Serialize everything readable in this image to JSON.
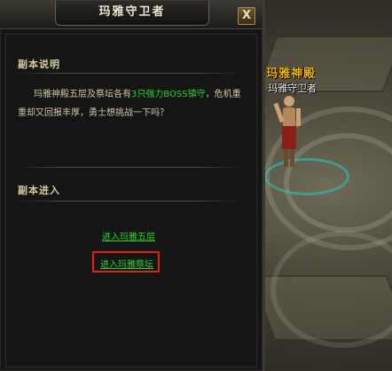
{
  "dialog": {
    "title": "玛雅守卫者",
    "close_label": "X",
    "desc_section": {
      "heading": "副本说明",
      "text_before": "玛雅神殿五层及祭坛各有",
      "text_highlight": "3只强力BOSS镇守",
      "text_after": "，危机重重却又回报丰厚，勇士想挑战一下吗？"
    },
    "enter_section": {
      "heading": "副本进入",
      "options": [
        {
          "label": "进入玛雅五层",
          "highlighted": false
        },
        {
          "label": "进入玛雅祭坛",
          "highlighted": true
        }
      ]
    }
  },
  "world": {
    "map_title": "玛雅神殿",
    "npc_name": "玛雅守卫者"
  },
  "colors": {
    "link_green": "#27d32c",
    "map_title_gold": "#f0b400",
    "highlight_red": "#e02020"
  }
}
